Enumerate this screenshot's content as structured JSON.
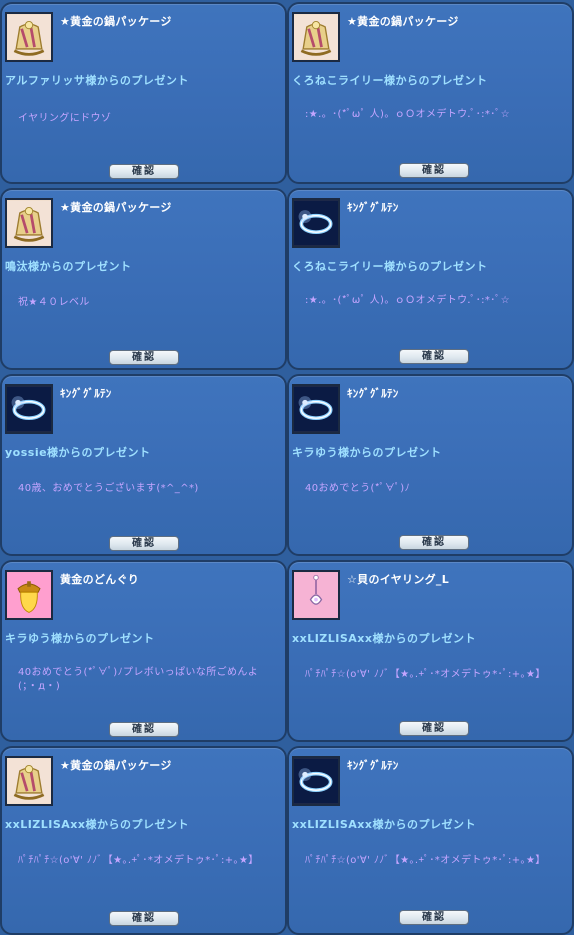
{
  "cards": [
    {
      "title": "★黄金の鍋パッケージ",
      "from": "アルファリッサ様からのプレゼント",
      "message": "イヤリングにドウゾ",
      "button": "確認",
      "icon": "golden-pot-icon"
    },
    {
      "title": "★黄金の鍋パッケージ",
      "from": "くろねこライリー様からのプレゼント",
      "message": ":★.。･(*ﾟωﾟ 人)。ｏＯオメデトウ.ﾟ･:*･ﾟ☆",
      "button": "確認",
      "icon": "golden-pot-icon"
    },
    {
      "title": "★黄金の鍋パッケージ",
      "from": "鳴汰様からのプレゼント",
      "message": "祝★４０レベル",
      "button": "確認",
      "icon": "golden-pot-icon"
    },
    {
      "title": "ｷﾝｸﾞｸﾞﾙﾃﾝ",
      "from": "くろねこライリー様からのプレゼント",
      "message": ":★.。･(*ﾟωﾟ 人)。ｏＯオメデトウ.ﾟ･:*･ﾟ☆",
      "button": "確認",
      "icon": "glowing-ring-icon"
    },
    {
      "title": "ｷﾝｸﾞｸﾞﾙﾃﾝ",
      "from": "yossie様からのプレゼント",
      "message": "40歳、おめでとうございます(*^_^*)",
      "button": "確認",
      "icon": "glowing-ring-icon"
    },
    {
      "title": "ｷﾝｸﾞｸﾞﾙﾃﾝ",
      "from": "キラゆう様からのプレゼント",
      "message": "40おめでとう(*ﾟ∀ﾟ)ﾉ",
      "button": "確認",
      "icon": "glowing-ring-icon"
    },
    {
      "title": "黄金のどんぐり",
      "from": "キラゆう様からのプレゼント",
      "message": "40おめでとう(*ﾟ∀ﾟ)ﾉプレボいっぱいな所ごめんよ(；・д・)",
      "button": "確認",
      "icon": "golden-acorn-icon"
    },
    {
      "title": "☆貝のイヤリング_L",
      "from": "xxLIZLISAxx様からのプレゼント",
      "message": "ﾊﾟﾁﾊﾟﾁ☆(o'∀' ﾉﾉﾞ【★｡.+ﾟ･*オメデトゥ*･ﾟ:+｡★】",
      "button": "確認",
      "icon": "shell-earring-icon"
    },
    {
      "title": "★黄金の鍋パッケージ",
      "from": "xxLIZLISAxx様からのプレゼント",
      "message": "ﾊﾟﾁﾊﾟﾁ☆(o'∀' ﾉﾉﾞ【★｡.+ﾟ･*オメデトゥ*･ﾟ:+｡★】",
      "button": "確認",
      "icon": "golden-pot-icon"
    },
    {
      "title": "ｷﾝｸﾞｸﾞﾙﾃﾝ",
      "from": "xxLIZLISAxx様からのプレゼント",
      "message": "ﾊﾟﾁﾊﾟﾁ☆(o'∀' ﾉﾉﾞ【★｡.+ﾟ･*オメデトゥ*･ﾟ:+｡★】",
      "button": "確認",
      "icon": "glowing-ring-icon"
    }
  ]
}
